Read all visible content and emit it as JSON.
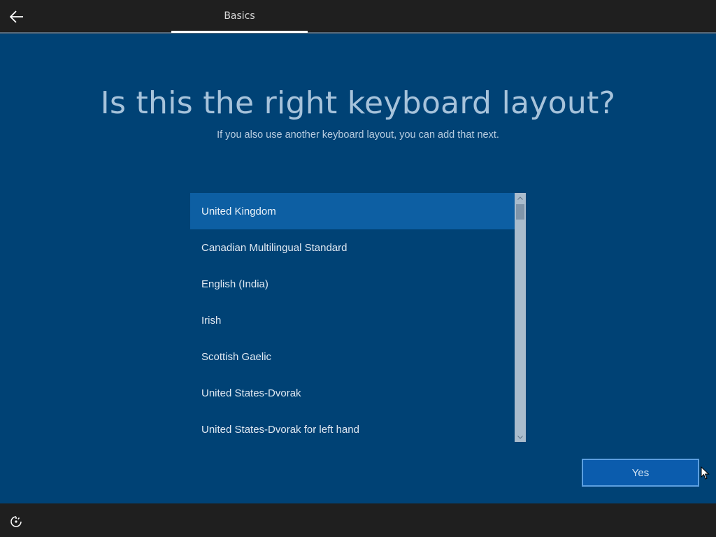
{
  "header": {
    "back_icon": "arrow-left-icon",
    "tab_label": "Basics"
  },
  "main": {
    "title": "Is this the right keyboard layout?",
    "subtitle": "If you also use another keyboard layout, you can add that next."
  },
  "layout_list": {
    "selected_index": 0,
    "items": [
      {
        "label": "United Kingdom"
      },
      {
        "label": "Canadian Multilingual Standard"
      },
      {
        "label": "English (India)"
      },
      {
        "label": "Irish"
      },
      {
        "label": "Scottish Gaelic"
      },
      {
        "label": "United States-Dvorak"
      },
      {
        "label": "United States-Dvorak for left hand"
      }
    ],
    "scroll_up_icon": "chevron-up-icon",
    "scroll_down_icon": "chevron-down-icon"
  },
  "footer": {
    "yes_label": "Yes",
    "accessibility_icon": "accessibility-icon"
  },
  "colors": {
    "background": "#004275",
    "selected_item": "#0d5fa3",
    "button": "#0b5cad",
    "bars": "#1f1f1f"
  }
}
